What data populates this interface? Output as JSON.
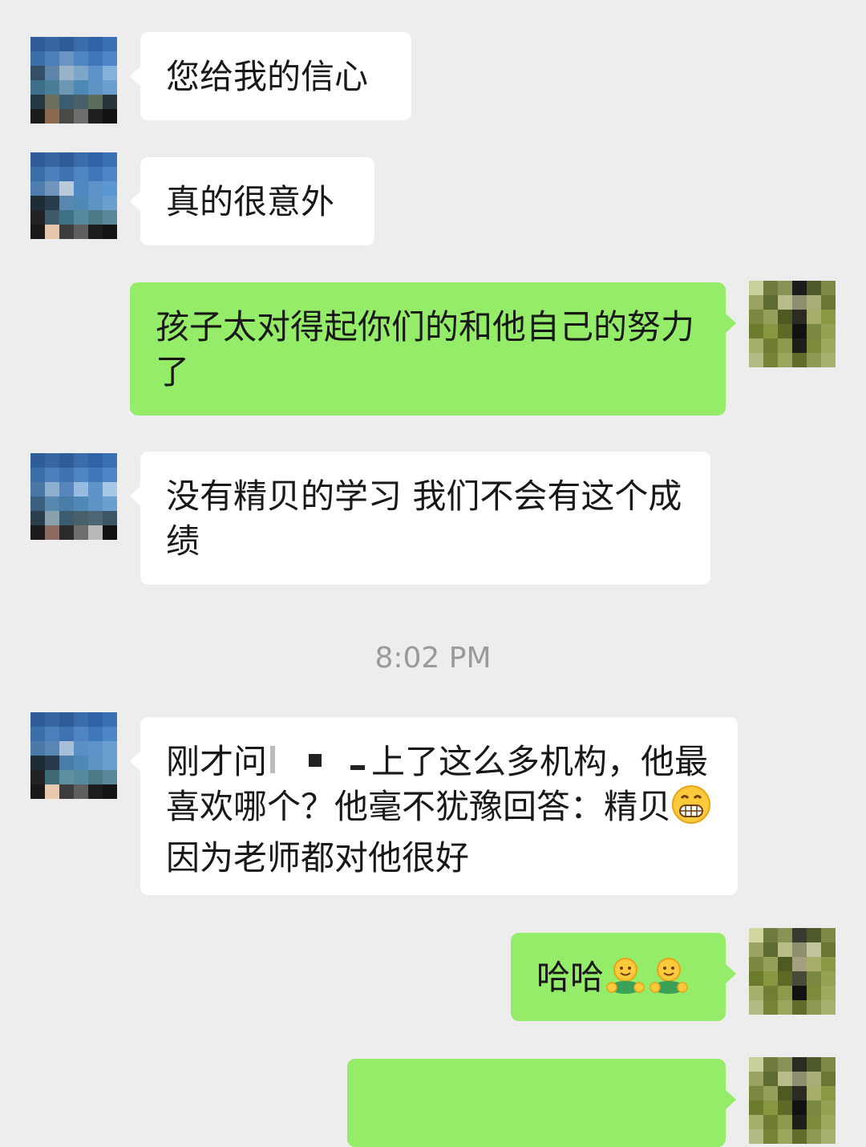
{
  "messages": [
    {
      "id": "m1",
      "direction": "incoming",
      "text": "您给我的信心"
    },
    {
      "id": "m2",
      "direction": "incoming",
      "text": "真的很意外"
    },
    {
      "id": "m3",
      "direction": "outgoing",
      "text": "孩子太对得起你们的和他自己的努力了"
    },
    {
      "id": "m4",
      "direction": "incoming",
      "text": "没有精贝的学习 我们不会有这个成绩"
    },
    {
      "id": "m5",
      "direction": "incoming",
      "text_part1": "刚才问",
      "text_part2": "上了这么多机构，他最喜欢哪个？他毫不犹豫回答：精贝",
      "emoji": "grinning-face-icon",
      "text_part3": "因为老师都对他很好"
    },
    {
      "id": "m6",
      "direction": "outgoing",
      "text": "哈哈",
      "emojis": [
        "hug-icon",
        "hug-icon"
      ]
    },
    {
      "id": "m7",
      "direction": "outgoing",
      "text": ""
    }
  ],
  "timestamp": "8:02 PM",
  "colors": {
    "background": "#ededed",
    "incoming_bubble": "#ffffff",
    "outgoing_bubble": "#95ec69",
    "text": "#181818",
    "timestamp": "#9a9a9a"
  }
}
